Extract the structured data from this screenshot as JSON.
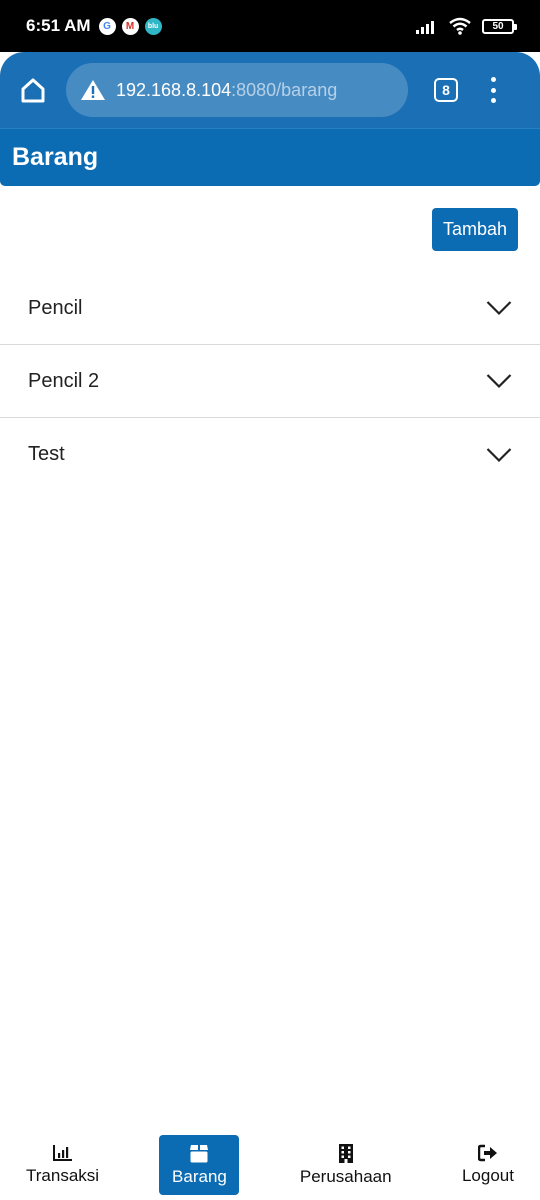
{
  "status_bar": {
    "time": "6:51 AM",
    "notifications": [
      "google-icon",
      "gmail-icon",
      "blu-app-icon"
    ],
    "blu_label": "blu",
    "battery_level": "50"
  },
  "browser": {
    "url_host": "192.168.8.104",
    "url_rest": ":8080/barang",
    "tab_count": "8"
  },
  "page": {
    "title": "Barang",
    "add_button_label": "Tambah"
  },
  "items": [
    {
      "name": "Pencil"
    },
    {
      "name": "Pencil 2"
    },
    {
      "name": "Test"
    }
  ],
  "bottom_nav": [
    {
      "label": "Transaksi",
      "icon": "chart-icon",
      "active": false
    },
    {
      "label": "Barang",
      "icon": "box-icon",
      "active": true
    },
    {
      "label": "Perusahaan",
      "icon": "building-icon",
      "active": false
    },
    {
      "label": "Logout",
      "icon": "logout-icon",
      "active": false
    }
  ],
  "colors": {
    "primary": "#0b6cb3",
    "browser_bar": "#1a6fb5"
  }
}
